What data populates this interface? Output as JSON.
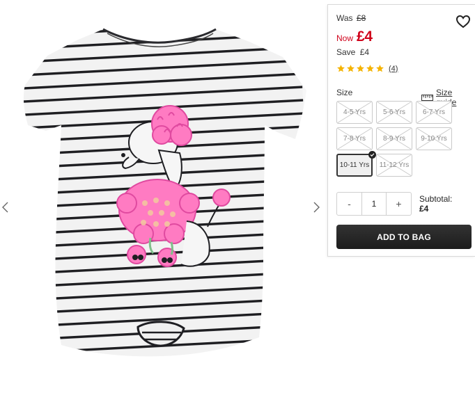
{
  "gallery": {
    "prev_icon": "chevron-left-icon",
    "next_icon": "chevron-right-icon",
    "image": "striped-poodle-tshirt"
  },
  "pricing": {
    "was_label": "Was",
    "was_price": "£8",
    "now_label": "Now",
    "now_price": "£4",
    "save_label": "Save",
    "save_amount": "£4",
    "sale_color": "#d0021b"
  },
  "rating": {
    "stars": 5,
    "max_stars": 5,
    "count": "(4)",
    "star_color": "#f5b301"
  },
  "size": {
    "label": "Size",
    "guide_label": "Size guide",
    "options": [
      {
        "label": "4-5 Yrs",
        "available": false,
        "selected": false
      },
      {
        "label": "5-6 Yrs",
        "available": false,
        "selected": false
      },
      {
        "label": "6-7 Yrs",
        "available": false,
        "selected": false
      },
      {
        "label": "7-8 Yrs",
        "available": false,
        "selected": false
      },
      {
        "label": "8-9 Yrs",
        "available": false,
        "selected": false
      },
      {
        "label": "9-10 Yrs",
        "available": false,
        "selected": false
      },
      {
        "label": "10-11 Yrs",
        "available": true,
        "selected": true
      },
      {
        "label": "11-12 Yrs",
        "available": false,
        "selected": false
      }
    ]
  },
  "quantity": {
    "minus": "-",
    "value": "1",
    "plus": "+"
  },
  "subtotal": {
    "label": "Subtotal:",
    "value": "£4"
  },
  "add_to_bag": "ADD TO BAG",
  "wishlist_icon": "heart-icon"
}
